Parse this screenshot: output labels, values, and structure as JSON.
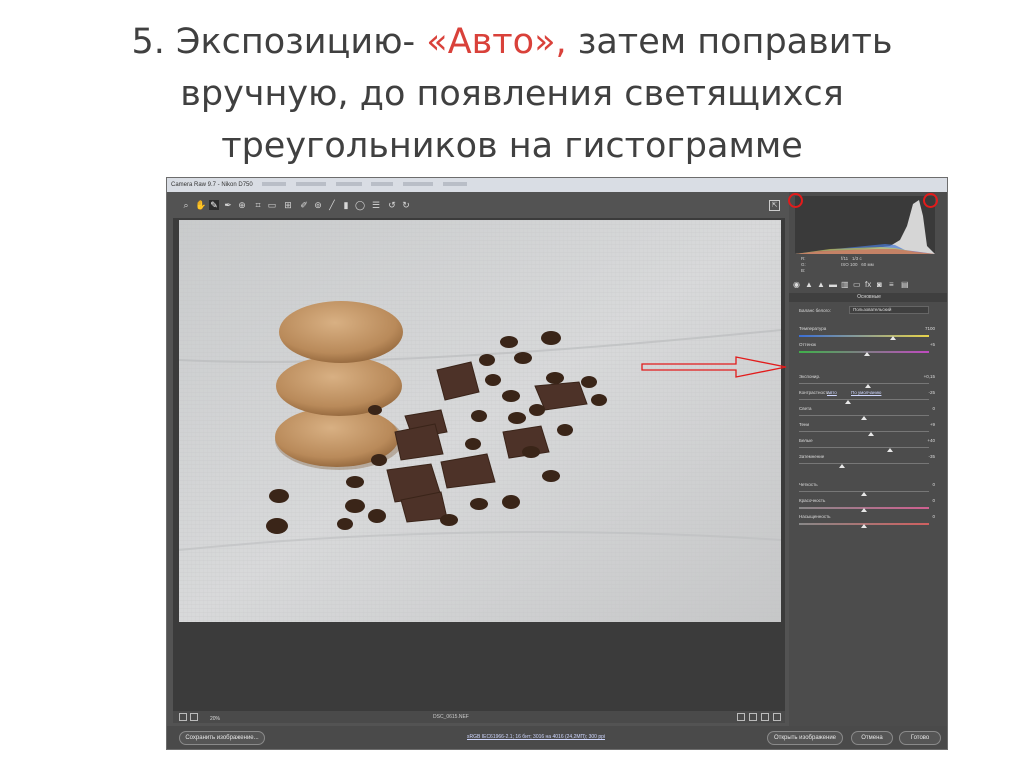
{
  "slide": {
    "title_lines": [
      [
        "5. Экспозицию- ",
        "«Авто»,",
        " затем поправить"
      ],
      [
        "вручную, до появления светящихся"
      ],
      [
        "треугольников на гистограмме"
      ]
    ]
  },
  "colors": {
    "title_text": "#404040",
    "title_accent": "#d9413a",
    "app_bg": "#535353",
    "annotation_red": "#e21b1b"
  },
  "app": {
    "window_title": "Camera Raw 9.7 - Nikon D750",
    "toolbar_icons": [
      "zoom-icon",
      "hand-icon",
      "white-balance-icon",
      "color-sampler-icon",
      "target-adjust-icon",
      "crop-icon",
      "straighten-icon",
      "transform-icon",
      "spot-removal-icon",
      "red-eye-icon",
      "adjustment-brush-icon",
      "graduated-filter-icon",
      "radial-filter-icon",
      "preferences-icon",
      "rotate-left-icon",
      "rotate-right-icon"
    ],
    "zoom": "20%",
    "filename": "DSC_0615.NEF",
    "workflow_options": "sRGB IEC61966-2.1; 16 бит; 3016 на 4016 (24,2МП); 300 ppi",
    "buttons": {
      "save": "Сохранить изображение...",
      "open": "Открыть изображение",
      "cancel": "Отмена",
      "done": "Готово"
    }
  },
  "histogram": {
    "info_left": [
      "R:",
      "G:",
      "B:"
    ],
    "info_values": [
      "f/11",
      "1/3 с",
      "ISO 100",
      "60 мм"
    ]
  },
  "panel": {
    "title": "Основные",
    "white_balance_label": "Баланс белого:",
    "white_balance_value": "Пользовательский",
    "auto_link": "Авто",
    "default_link": "По умолчанию",
    "sliders": [
      {
        "label": "Температура",
        "value": "7100",
        "pos": 0.72
      },
      {
        "label": "Оттенок",
        "value": "+5",
        "pos": 0.52
      },
      {
        "label": "Экспонир.",
        "value": "+0,15",
        "pos": 0.53
      },
      {
        "label": "Контрастность",
        "value": "-25",
        "pos": 0.38
      },
      {
        "label": "Света",
        "value": "0",
        "pos": 0.5
      },
      {
        "label": "Тени",
        "value": "+9",
        "pos": 0.55
      },
      {
        "label": "Белые",
        "value": "+40",
        "pos": 0.7
      },
      {
        "label": "Затемнение",
        "value": "-35",
        "pos": 0.33
      },
      {
        "label": "Четкость",
        "value": "0",
        "pos": 0.5
      },
      {
        "label": "Красочность",
        "value": "0",
        "pos": 0.5
      },
      {
        "label": "Насыщенность",
        "value": "0",
        "pos": 0.5
      }
    ]
  }
}
